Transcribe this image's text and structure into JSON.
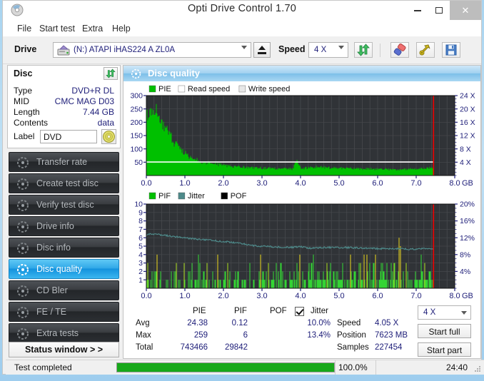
{
  "window": {
    "title": "Opti Drive Control 1.70",
    "minimize": "–",
    "maximize": "□",
    "close": "✕"
  },
  "menu": [
    "File",
    "Start test",
    "Extra",
    "Help"
  ],
  "toolbar": {
    "drive_label": "Drive",
    "drive_value": "(N:)  ATAPI iHAS224  A ZL0A",
    "eject_name": "eject-button",
    "speed_label": "Speed",
    "speed_value": "4 X",
    "refresh_name": "refresh-icon",
    "erase_name": "erase-icon",
    "tools_name": "tools-icon",
    "save_name": "save-icon"
  },
  "disc": {
    "header": "Disc",
    "rows": [
      {
        "label": "Type",
        "value": "DVD+R DL"
      },
      {
        "label": "MID",
        "value": "CMC MAG D03"
      },
      {
        "label": "Length",
        "value": "7.44 GB"
      },
      {
        "label": "Contents",
        "value": "data"
      }
    ],
    "label_field_label": "Label",
    "label_field_value": "DVD"
  },
  "nav": {
    "items": [
      {
        "label": "Transfer rate",
        "active": false
      },
      {
        "label": "Create test disc",
        "active": false
      },
      {
        "label": "Verify test disc",
        "active": false
      },
      {
        "label": "Drive info",
        "active": false
      },
      {
        "label": "Disc info",
        "active": false
      },
      {
        "label": "Disc quality",
        "active": true
      },
      {
        "label": "CD Bler",
        "active": false
      },
      {
        "label": "FE / TE",
        "active": false
      },
      {
        "label": "Extra tests",
        "active": false
      }
    ],
    "status_window": "Status window > >"
  },
  "panel": {
    "title": "Disc quality"
  },
  "chart_data": [
    {
      "type": "area",
      "name": "pie-chart",
      "title": "PIE",
      "legend": [
        {
          "label": "PIE",
          "color": "#00c000"
        },
        {
          "label": "Read speed",
          "color": "#ffffff"
        },
        {
          "label": "Write speed",
          "color": "#e8e8e8"
        }
      ],
      "xlabel": "GB",
      "xticks": [
        "0.0",
        "1.0",
        "2.0",
        "3.0",
        "4.0",
        "5.0",
        "6.0",
        "7.0",
        "8.0"
      ],
      "xlim": [
        0,
        8
      ],
      "yticks_left": [
        "300",
        "250",
        "200",
        "150",
        "100",
        "50"
      ],
      "ylim_left": [
        0,
        300
      ],
      "yticks_right": [
        "24 X",
        "20 X",
        "16 X",
        "12 X",
        "8 X",
        "4 X"
      ],
      "ylim_right": [
        0,
        24
      ],
      "grid": true,
      "read_speed_flat": 4.05,
      "scan_end_gb": 7.45,
      "series": [
        {
          "name": "PIE",
          "color": "#00c000",
          "x": [
            0.0,
            0.05,
            0.1,
            0.15,
            0.2,
            0.25,
            0.3,
            0.35,
            0.4,
            0.45,
            0.5,
            0.55,
            0.6,
            0.65,
            0.7,
            0.75,
            0.8,
            0.85,
            0.9,
            0.95,
            1.0,
            1.1,
            1.2,
            1.3,
            1.4,
            1.5,
            1.6,
            1.7,
            1.8,
            1.9,
            2.0,
            2.2,
            2.4,
            2.6,
            2.8,
            3.0,
            3.2,
            3.4,
            3.6,
            3.8,
            3.9,
            4.0,
            4.2,
            4.4,
            4.6,
            4.8,
            5.0,
            5.2,
            5.4,
            5.6,
            5.8,
            6.0,
            6.2,
            6.4,
            6.6,
            6.8,
            7.0,
            7.2,
            7.4,
            7.45
          ],
          "y": [
            218,
            232,
            224,
            238,
            222,
            258,
            230,
            205,
            196,
            186,
            176,
            162,
            150,
            142,
            122,
            118,
            108,
            100,
            96,
            88,
            82,
            70,
            62,
            58,
            52,
            48,
            46,
            44,
            42,
            40,
            38,
            34,
            32,
            30,
            28,
            27,
            26,
            25,
            25,
            24,
            60,
            26,
            28,
            32,
            30,
            28,
            27,
            26,
            25,
            24,
            24,
            23,
            23,
            22,
            22,
            23,
            24,
            26,
            28,
            20
          ]
        }
      ],
      "redline_gb": 7.45
    },
    {
      "type": "bar",
      "name": "pif-chart",
      "title": "PIF",
      "legend": [
        {
          "label": "PIF",
          "color": "#00c000"
        },
        {
          "label": "Jitter",
          "color": "#4e8a8a"
        },
        {
          "label": "POF",
          "color": "#000000"
        }
      ],
      "xlabel": "GB",
      "xticks": [
        "0.0",
        "1.0",
        "2.0",
        "3.0",
        "4.0",
        "5.0",
        "6.0",
        "7.0",
        "8.0"
      ],
      "xlim": [
        0,
        8
      ],
      "yticks_left": [
        "10",
        "9",
        "8",
        "7",
        "6",
        "5",
        "4",
        "3",
        "2",
        "1"
      ],
      "ylim_left": [
        0,
        10
      ],
      "yticks_right": [
        "20%",
        "16%",
        "12%",
        "8%",
        "4%"
      ],
      "ylim_right": [
        0,
        20
      ],
      "grid": true,
      "jitter_series": {
        "name": "Jitter",
        "color": "#4e8a8a",
        "x": [
          0.0,
          0.1,
          0.2,
          0.3,
          0.4,
          0.5,
          0.6,
          0.7,
          0.8,
          0.9,
          1.0,
          1.2,
          1.4,
          1.6,
          1.8,
          2.0,
          2.2,
          2.4,
          2.6,
          2.8,
          3.0,
          3.2,
          3.4,
          3.6,
          3.8,
          4.0,
          4.2,
          4.4,
          4.6,
          4.8,
          5.0,
          5.2,
          5.4,
          5.6,
          5.8,
          6.0,
          6.2,
          6.4,
          6.6,
          6.8,
          7.0,
          7.2,
          7.4,
          7.45
        ],
        "y": [
          6.3,
          6.5,
          6.45,
          6.4,
          6.35,
          6.3,
          6.2,
          6.15,
          6.1,
          6.05,
          6.0,
          5.9,
          5.8,
          5.75,
          5.65,
          5.55,
          5.45,
          5.35,
          5.2,
          5.05,
          5.0,
          4.95,
          4.9,
          4.9,
          4.85,
          4.95,
          4.75,
          4.8,
          4.85,
          4.85,
          4.8,
          4.85,
          4.8,
          4.75,
          4.75,
          4.7,
          4.7,
          4.7,
          4.7,
          4.65,
          4.65,
          4.7,
          4.7,
          4.65
        ]
      },
      "redline_gb": 7.45
    }
  ],
  "stats": {
    "col_headers": [
      "PIE",
      "PIF",
      "POF"
    ],
    "jitter_label": "Jitter",
    "jitter_checked": true,
    "row_labels": [
      "Avg",
      "Max",
      "Total"
    ],
    "pie": [
      "24.38",
      "259",
      "743466"
    ],
    "pif": [
      "0.12",
      "6",
      "29842"
    ],
    "pof": [
      "",
      "",
      ""
    ],
    "jitter": [
      "10.0%",
      "13.4%",
      ""
    ],
    "speed_label": "Speed",
    "speed_value": "4.05 X",
    "position_label": "Position",
    "position_value": "7623 MB",
    "samples_label": "Samples",
    "samples_value": "227454",
    "speed_select": "4 X",
    "start_full": "Start full",
    "start_part": "Start part"
  },
  "statusbar": {
    "message": "Test completed",
    "progress_percent": 100,
    "progress_text": "100.0%",
    "elapsed": "24:40"
  }
}
